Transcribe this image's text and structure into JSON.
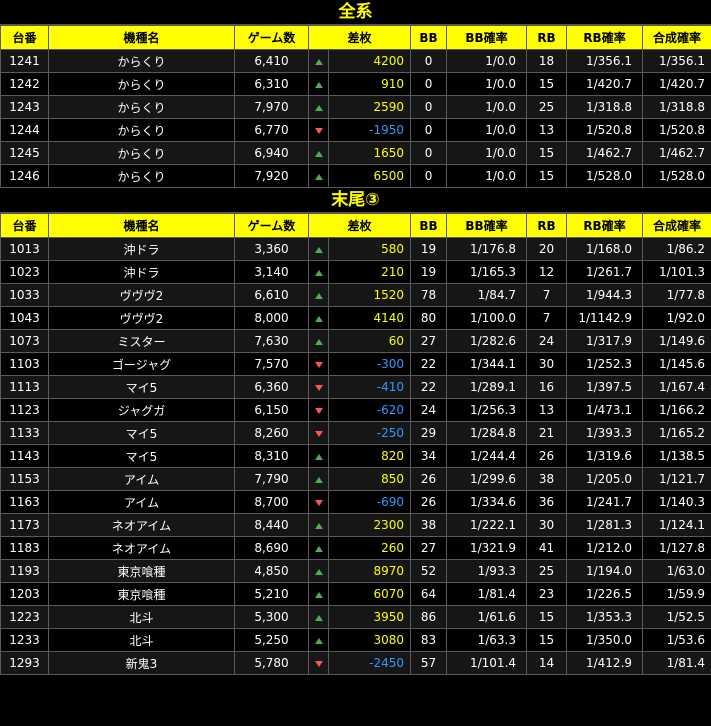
{
  "colors": {
    "header_bg": "#ffff00",
    "positive": "#ffff00",
    "negative": "#2b9cff",
    "up_arrow": "#4caf50",
    "down_arrow": "#ff5555"
  },
  "icons": {
    "up": "triangle-up-icon",
    "down": "triangle-down-icon"
  },
  "columns": [
    "台番",
    "機種名",
    "ゲーム数",
    "差枚",
    "BB",
    "BB確率",
    "RB",
    "RB確率",
    "合成確率"
  ],
  "sections": [
    {
      "title": "全系",
      "rows": [
        {
          "id": "1241",
          "model": "からくり",
          "games": "6,410",
          "dir": "up",
          "diff": "4200",
          "bb": "0",
          "bb_rate": "1/0.0",
          "rb": "18",
          "rb_rate": "1/356.1",
          "total_rate": "1/356.1"
        },
        {
          "id": "1242",
          "model": "からくり",
          "games": "6,310",
          "dir": "up",
          "diff": "910",
          "bb": "0",
          "bb_rate": "1/0.0",
          "rb": "15",
          "rb_rate": "1/420.7",
          "total_rate": "1/420.7"
        },
        {
          "id": "1243",
          "model": "からくり",
          "games": "7,970",
          "dir": "up",
          "diff": "2590",
          "bb": "0",
          "bb_rate": "1/0.0",
          "rb": "25",
          "rb_rate": "1/318.8",
          "total_rate": "1/318.8"
        },
        {
          "id": "1244",
          "model": "からくり",
          "games": "6,770",
          "dir": "down",
          "diff": "-1950",
          "bb": "0",
          "bb_rate": "1/0.0",
          "rb": "13",
          "rb_rate": "1/520.8",
          "total_rate": "1/520.8"
        },
        {
          "id": "1245",
          "model": "からくり",
          "games": "6,940",
          "dir": "up",
          "diff": "1650",
          "bb": "0",
          "bb_rate": "1/0.0",
          "rb": "15",
          "rb_rate": "1/462.7",
          "total_rate": "1/462.7"
        },
        {
          "id": "1246",
          "model": "からくり",
          "games": "7,920",
          "dir": "up",
          "diff": "6500",
          "bb": "0",
          "bb_rate": "1/0.0",
          "rb": "15",
          "rb_rate": "1/528.0",
          "total_rate": "1/528.0"
        }
      ]
    },
    {
      "title": "末尾③",
      "rows": [
        {
          "id": "1013",
          "model": "沖ドラ",
          "games": "3,360",
          "dir": "up",
          "diff": "580",
          "bb": "19",
          "bb_rate": "1/176.8",
          "rb": "20",
          "rb_rate": "1/168.0",
          "total_rate": "1/86.2"
        },
        {
          "id": "1023",
          "model": "沖ドラ",
          "games": "3,140",
          "dir": "up",
          "diff": "210",
          "bb": "19",
          "bb_rate": "1/165.3",
          "rb": "12",
          "rb_rate": "1/261.7",
          "total_rate": "1/101.3"
        },
        {
          "id": "1033",
          "model": "ヴヴヴ2",
          "games": "6,610",
          "dir": "up",
          "diff": "1520",
          "bb": "78",
          "bb_rate": "1/84.7",
          "rb": "7",
          "rb_rate": "1/944.3",
          "total_rate": "1/77.8"
        },
        {
          "id": "1043",
          "model": "ヴヴヴ2",
          "games": "8,000",
          "dir": "up",
          "diff": "4140",
          "bb": "80",
          "bb_rate": "1/100.0",
          "rb": "7",
          "rb_rate": "1/1142.9",
          "total_rate": "1/92.0"
        },
        {
          "id": "1073",
          "model": "ミスター",
          "games": "7,630",
          "dir": "up",
          "diff": "60",
          "bb": "27",
          "bb_rate": "1/282.6",
          "rb": "24",
          "rb_rate": "1/317.9",
          "total_rate": "1/149.6"
        },
        {
          "id": "1103",
          "model": "ゴージャグ",
          "games": "7,570",
          "dir": "down",
          "diff": "-300",
          "bb": "22",
          "bb_rate": "1/344.1",
          "rb": "30",
          "rb_rate": "1/252.3",
          "total_rate": "1/145.6"
        },
        {
          "id": "1113",
          "model": "マイ5",
          "games": "6,360",
          "dir": "down",
          "diff": "-410",
          "bb": "22",
          "bb_rate": "1/289.1",
          "rb": "16",
          "rb_rate": "1/397.5",
          "total_rate": "1/167.4"
        },
        {
          "id": "1123",
          "model": "ジャグガ",
          "games": "6,150",
          "dir": "down",
          "diff": "-620",
          "bb": "24",
          "bb_rate": "1/256.3",
          "rb": "13",
          "rb_rate": "1/473.1",
          "total_rate": "1/166.2"
        },
        {
          "id": "1133",
          "model": "マイ5",
          "games": "8,260",
          "dir": "down",
          "diff": "-250",
          "bb": "29",
          "bb_rate": "1/284.8",
          "rb": "21",
          "rb_rate": "1/393.3",
          "total_rate": "1/165.2"
        },
        {
          "id": "1143",
          "model": "マイ5",
          "games": "8,310",
          "dir": "up",
          "diff": "820",
          "bb": "34",
          "bb_rate": "1/244.4",
          "rb": "26",
          "rb_rate": "1/319.6",
          "total_rate": "1/138.5"
        },
        {
          "id": "1153",
          "model": "アイム",
          "games": "7,790",
          "dir": "up",
          "diff": "850",
          "bb": "26",
          "bb_rate": "1/299.6",
          "rb": "38",
          "rb_rate": "1/205.0",
          "total_rate": "1/121.7"
        },
        {
          "id": "1163",
          "model": "アイム",
          "games": "8,700",
          "dir": "down",
          "diff": "-690",
          "bb": "26",
          "bb_rate": "1/334.6",
          "rb": "36",
          "rb_rate": "1/241.7",
          "total_rate": "1/140.3"
        },
        {
          "id": "1173",
          "model": "ネオアイム",
          "games": "8,440",
          "dir": "up",
          "diff": "2300",
          "bb": "38",
          "bb_rate": "1/222.1",
          "rb": "30",
          "rb_rate": "1/281.3",
          "total_rate": "1/124.1"
        },
        {
          "id": "1183",
          "model": "ネオアイム",
          "games": "8,690",
          "dir": "up",
          "diff": "260",
          "bb": "27",
          "bb_rate": "1/321.9",
          "rb": "41",
          "rb_rate": "1/212.0",
          "total_rate": "1/127.8"
        },
        {
          "id": "1193",
          "model": "東京喰種",
          "games": "4,850",
          "dir": "up",
          "diff": "8970",
          "bb": "52",
          "bb_rate": "1/93.3",
          "rb": "25",
          "rb_rate": "1/194.0",
          "total_rate": "1/63.0"
        },
        {
          "id": "1203",
          "model": "東京喰種",
          "games": "5,210",
          "dir": "up",
          "diff": "6070",
          "bb": "64",
          "bb_rate": "1/81.4",
          "rb": "23",
          "rb_rate": "1/226.5",
          "total_rate": "1/59.9"
        },
        {
          "id": "1223",
          "model": "北斗",
          "games": "5,300",
          "dir": "up",
          "diff": "3950",
          "bb": "86",
          "bb_rate": "1/61.6",
          "rb": "15",
          "rb_rate": "1/353.3",
          "total_rate": "1/52.5"
        },
        {
          "id": "1233",
          "model": "北斗",
          "games": "5,250",
          "dir": "up",
          "diff": "3080",
          "bb": "83",
          "bb_rate": "1/63.3",
          "rb": "15",
          "rb_rate": "1/350.0",
          "total_rate": "1/53.6"
        },
        {
          "id": "1293",
          "model": "新鬼3",
          "games": "5,780",
          "dir": "down",
          "diff": "-2450",
          "bb": "57",
          "bb_rate": "1/101.4",
          "rb": "14",
          "rb_rate": "1/412.9",
          "total_rate": "1/81.4"
        }
      ]
    }
  ]
}
